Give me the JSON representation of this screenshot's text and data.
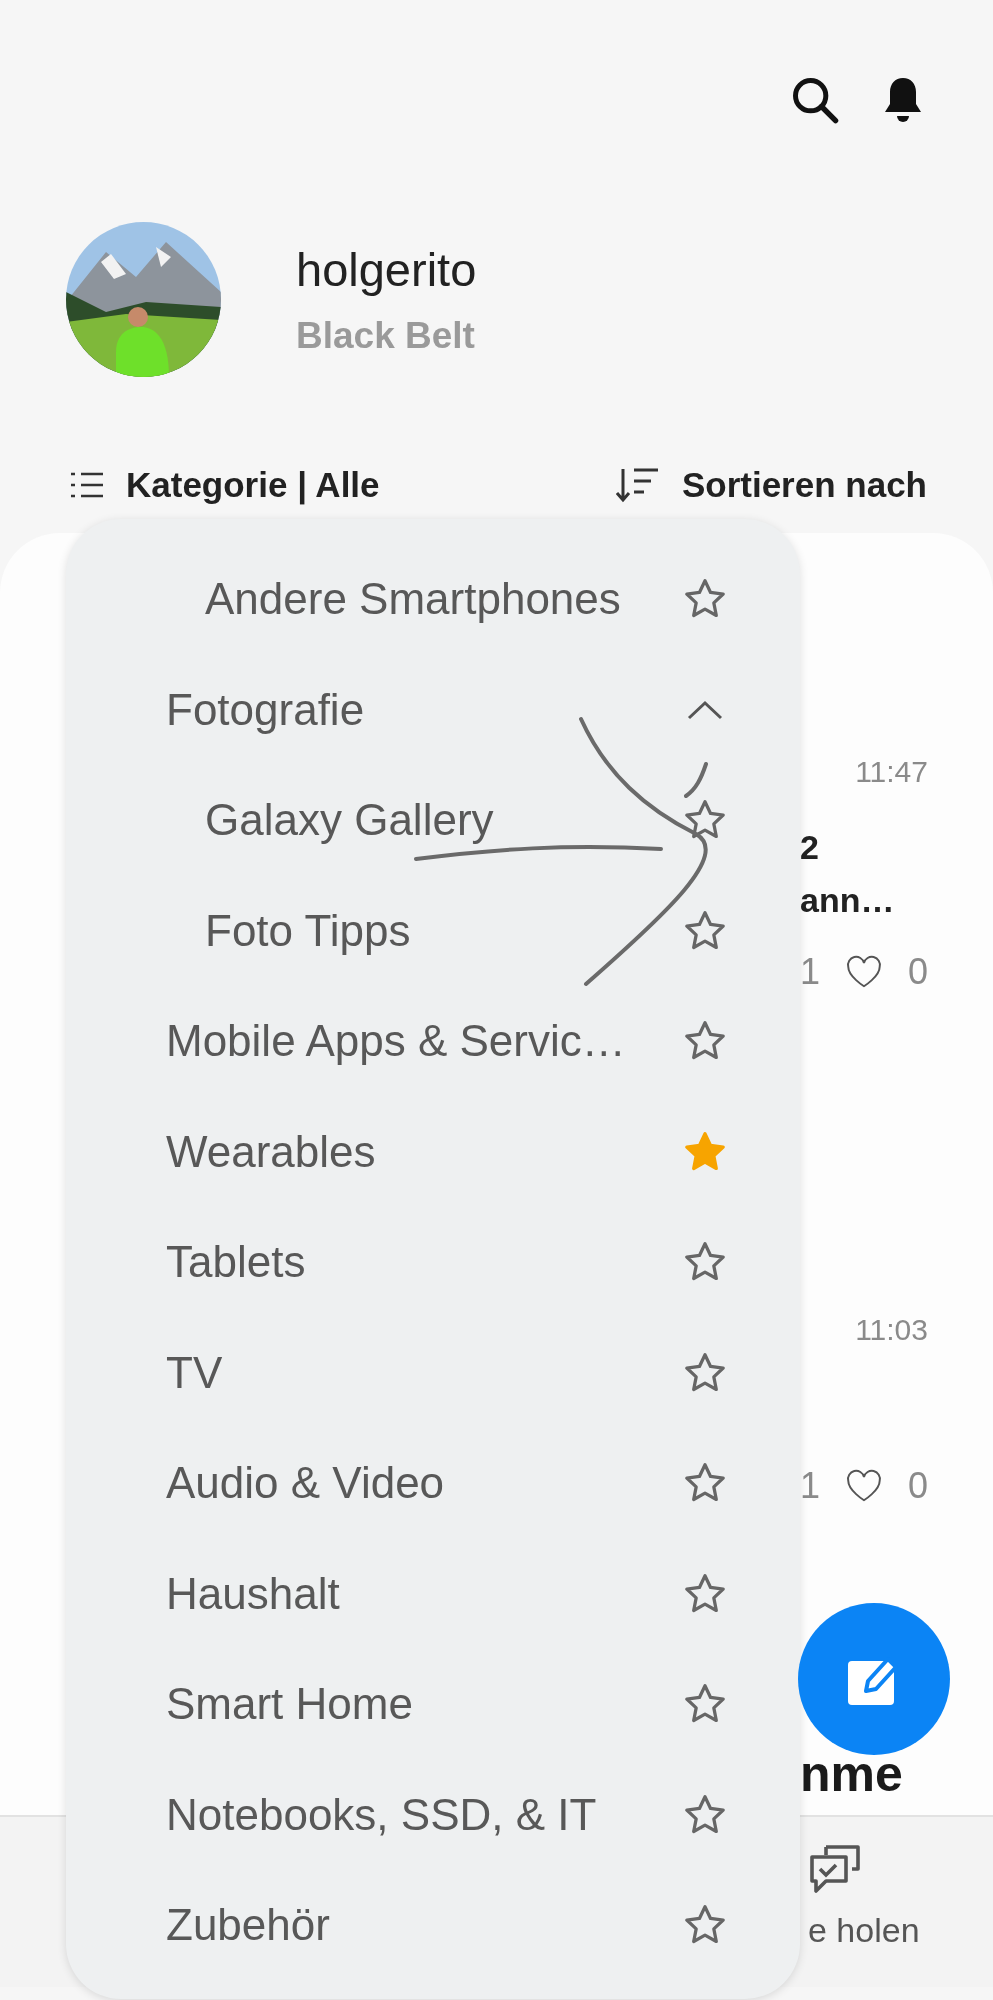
{
  "profile": {
    "username": "holgerito",
    "rank": "Black Belt"
  },
  "filter_bar": {
    "category": "Kategorie | Alle",
    "sort": "Sortieren nach"
  },
  "posts": [
    {
      "time": "11:47",
      "title_fragment": "2",
      "text_fragment": "ann…",
      "comments": "1",
      "likes": "0"
    },
    {
      "time": "11:03",
      "comments": "1",
      "likes": "0"
    }
  ],
  "section_heading_fragment": "nme",
  "bottom_nav": [
    {
      "label": "e holen"
    }
  ],
  "category_menu": {
    "items": [
      {
        "kind": "group_tail",
        "children": [
          {
            "label": "Andere Smartphones",
            "starred": false
          }
        ]
      },
      {
        "kind": "group",
        "label": "Fotografie",
        "expanded": true,
        "children": [
          {
            "label": "Galaxy Gallery",
            "starred": false
          },
          {
            "label": "Foto Tipps",
            "starred": false
          }
        ]
      },
      {
        "kind": "item",
        "label": "Mobile Apps & Servic…",
        "starred": false
      },
      {
        "kind": "item",
        "label": "Wearables",
        "starred": true
      },
      {
        "kind": "item",
        "label": "Tablets",
        "starred": false
      },
      {
        "kind": "item",
        "label": "TV",
        "starred": false
      },
      {
        "kind": "item",
        "label": "Audio & Video",
        "starred": false
      },
      {
        "kind": "item",
        "label": "Haushalt",
        "starred": false
      },
      {
        "kind": "item",
        "label": "Smart Home",
        "starred": false
      },
      {
        "kind": "item",
        "label": "Notebooks, SSD, & IT",
        "starred": false
      },
      {
        "kind": "item",
        "label": "Zubehör",
        "starred": false
      }
    ]
  }
}
